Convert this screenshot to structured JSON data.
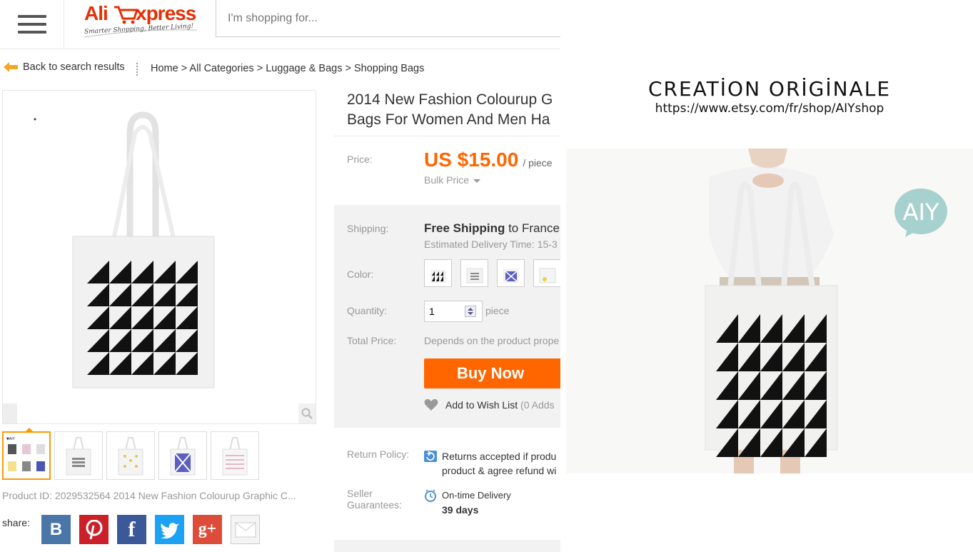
{
  "header": {
    "logo_text": "AliExpress",
    "logo_tagline": "Smarter Shopping, Better Living!",
    "search_placeholder": "I'm shopping for..."
  },
  "breadcrumb": {
    "back_label": "Back to search results",
    "items": [
      "Home",
      "All Categories",
      "Luggage & Bags",
      "Shopping Bags"
    ],
    "separator": " > "
  },
  "product": {
    "title_line1": "2014 New Fashion Colourup G",
    "title_line2": "Bags For Women And Men Ha",
    "price_label": "Price:",
    "price": "US $15.00",
    "price_unit": "/ piece",
    "bulk_price": "Bulk Price",
    "shipping_label": "Shipping:",
    "shipping_free": "Free Shipping",
    "shipping_to": "to",
    "shipping_country": "France",
    "estimated_delivery": "Estimated Delivery Time: 15-3",
    "color_label": "Color:",
    "quantity_label": "Quantity:",
    "quantity_value": "1",
    "quantity_unit": "piece",
    "total_label": "Total Price:",
    "total_value": "Depends on the product prope",
    "buy_now": "Buy Now",
    "wish_list": "Add to Wish List",
    "wish_count": "(0 Adds",
    "return_label": "Return Policy:",
    "return_line1": "Returns accepted if produ",
    "return_line2": "product & agree refund wi",
    "seller_label_1": "Seller",
    "seller_label_2": "Guarantees:",
    "ontime": "On-time Delivery",
    "ontime_days": "39 days",
    "product_id": "Product ID: 2029532564 2014 New Fashion Colourup Graphic C...",
    "share_label": "share:"
  },
  "share": {
    "icons": [
      "vk-icon",
      "pinterest-icon",
      "facebook-icon",
      "twitter-icon",
      "google-plus-icon",
      "email-icon"
    ],
    "colors": [
      "#4a76a8",
      "#cb2027",
      "#3b5998",
      "#1da1f2",
      "#dd4b39",
      "#f4f4f4"
    ],
    "glyphs": [
      "B",
      "P",
      "f",
      "t",
      "g+",
      ""
    ]
  },
  "poster": {
    "title": "CREATİON ORİGİNALE",
    "url": "https://www.etsy.com/fr/shop/AIYshop",
    "logo_text": "AIY"
  },
  "colors": {
    "accent": "#ff6600",
    "brand": "#e62e04"
  }
}
